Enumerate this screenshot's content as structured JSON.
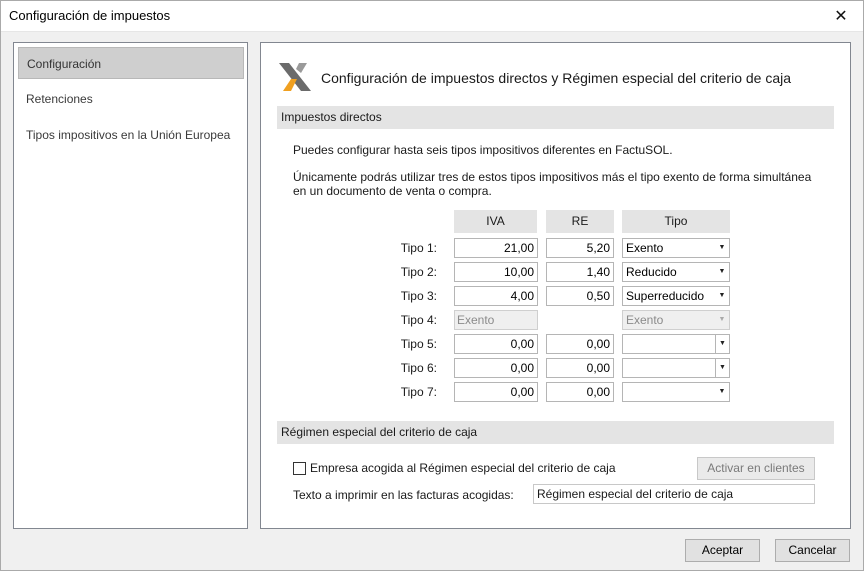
{
  "window": {
    "title": "Configuración de impuestos",
    "close_glyph": "✕"
  },
  "nav": {
    "items": [
      {
        "label": "Configuración",
        "selected": true
      },
      {
        "label": "Retenciones",
        "selected": false
      },
      {
        "label": "Tipos impositivos en la Unión Europea",
        "selected": false
      }
    ]
  },
  "main": {
    "heading": "Configuración de impuestos directos y Régimen especial del criterio de caja",
    "logo_icon": "factusol-x-logo",
    "section1": {
      "title": "Impuestos directos",
      "para1": "Puedes configurar hasta seis tipos impositivos diferentes en FactuSOL.",
      "para2_line1": "Únicamente podrás utilizar tres de estos tipos impositivos más el tipo exento de forma simultánea",
      "para2_line2": "en un documento de venta o compra."
    },
    "table": {
      "col_iva": "IVA",
      "col_re": "RE",
      "col_tipo": "Tipo",
      "rows": [
        {
          "label": "Tipo 1:",
          "iva": "21,00",
          "re": "5,20",
          "tipo": "Exento"
        },
        {
          "label": "Tipo 2:",
          "iva": "10,00",
          "re": "1,40",
          "tipo": "Reducido"
        },
        {
          "label": "Tipo 3:",
          "iva": "4,00",
          "re": "0,50",
          "tipo": "Superreducido"
        },
        {
          "label": "Tipo 4:",
          "iva": "Exento",
          "re": "",
          "tipo": "Exento"
        },
        {
          "label": "Tipo 5:",
          "iva": "0,00",
          "re": "0,00",
          "tipo": ""
        },
        {
          "label": "Tipo 6:",
          "iva": "0,00",
          "re": "0,00",
          "tipo": ""
        },
        {
          "label": "Tipo 7:",
          "iva": "0,00",
          "re": "0,00",
          "tipo": ""
        }
      ]
    },
    "section2": {
      "title": "Régimen especial del criterio de caja",
      "checkbox_label": "Empresa acogida al Régimen especial del criterio de caja",
      "checkbox_checked": false,
      "activate_button": "Activar en clientes",
      "print_label": "Texto a imprimir en las facturas acogidas:",
      "print_value": "Régimen especial del criterio de caja"
    }
  },
  "footer": {
    "accept": "Aceptar",
    "cancel": "Cancelar"
  },
  "colors": {
    "section_bg": "#e4e4e4",
    "nav_selected_bg": "#cfcfcf",
    "window_bg": "#f0f0f0"
  }
}
